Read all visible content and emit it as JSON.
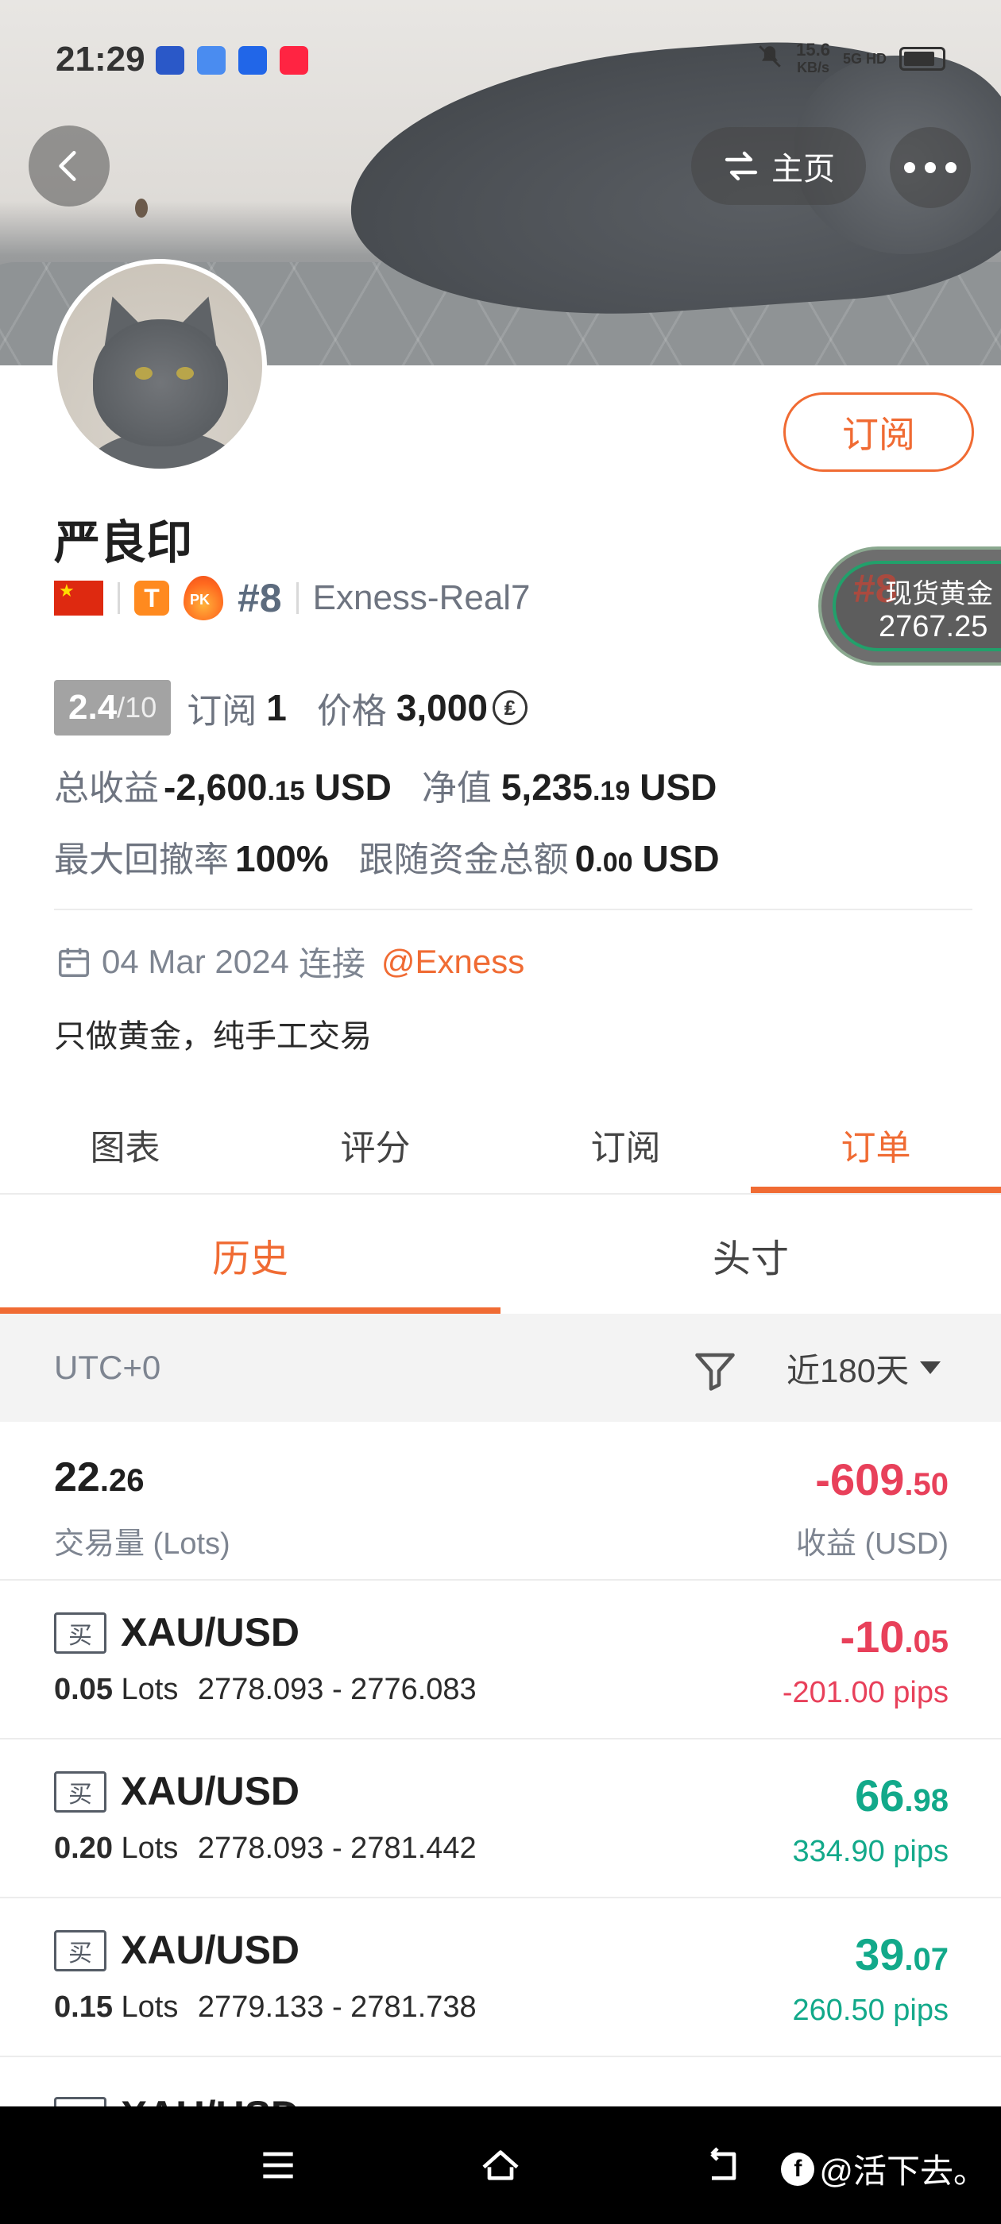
{
  "status_bar": {
    "time": "21:29",
    "net_speed": "15.6",
    "net_unit": "KB/s",
    "network": "5G HD"
  },
  "header": {
    "home_label": "主页"
  },
  "profile": {
    "name": "严良印",
    "rank": "#8",
    "broker": "Exness-Real7",
    "subscribe_label": "订阅",
    "score": "2.4",
    "score_max": "/10",
    "subs_label": "订阅",
    "subs_count": "1",
    "price_label": "价格",
    "price": "3,000",
    "coin_symbol": "₤",
    "total_profit_label": "总收益",
    "total_profit_int": "-2,600",
    "total_profit_dec": ".15",
    "total_profit_unit": "USD",
    "equity_label": "净值",
    "equity_int": "5,235",
    "equity_dec": ".19",
    "equity_unit": "USD",
    "drawdown_label": "最大回撤率",
    "drawdown": "100%",
    "follow_label": "跟随资金总额",
    "follow_int": "0",
    "follow_dec": ".00",
    "follow_unit": "USD",
    "connect_date": "04 Mar 2024",
    "connect_text": "连接",
    "connect_at": "@Exness",
    "bio": "只做黄金，纯手工交易"
  },
  "gold_widget": {
    "label": "现货黄金",
    "price": "2767.25",
    "ghost": "#8"
  },
  "tabs": [
    "图表",
    "评分",
    "订阅",
    "订单"
  ],
  "active_tab": 3,
  "sub_tabs": [
    "历史",
    "头寸"
  ],
  "filter": {
    "timezone": "UTC+0",
    "range": "近180天"
  },
  "summary": {
    "volume_int": "22",
    "volume_dec": ".26",
    "volume_label": "交易量 (Lots)",
    "pnl_int": "-609",
    "pnl_dec": ".50",
    "pnl_label": "收益 (USD)"
  },
  "orders": [
    {
      "side": "买",
      "symbol": "XAU/USD",
      "lots": "0.05",
      "lots_unit": "Lots",
      "range": "2778.093 - 2776.083",
      "profit_int": "-10",
      "profit_dec": ".05",
      "pips": "-201.00 pips",
      "positive": false
    },
    {
      "side": "买",
      "symbol": "XAU/USD",
      "lots": "0.20",
      "lots_unit": "Lots",
      "range": "2778.093 - 2781.442",
      "profit_int": "66",
      "profit_dec": ".98",
      "pips": "334.90 pips",
      "positive": true
    },
    {
      "side": "买",
      "symbol": "XAU/USD",
      "lots": "0.15",
      "lots_unit": "Lots",
      "range": "2779.133 - 2781.738",
      "profit_int": "39",
      "profit_dec": ".07",
      "pips": "260.50 pips",
      "positive": true
    }
  ],
  "partial_order": {
    "symbol": "XAU/USD"
  },
  "watermark": {
    "logo": "f",
    "text": "@活下去。"
  },
  "colors": {
    "accent": "#f06b33",
    "negative": "#e8405a",
    "positive": "#12a98a"
  }
}
